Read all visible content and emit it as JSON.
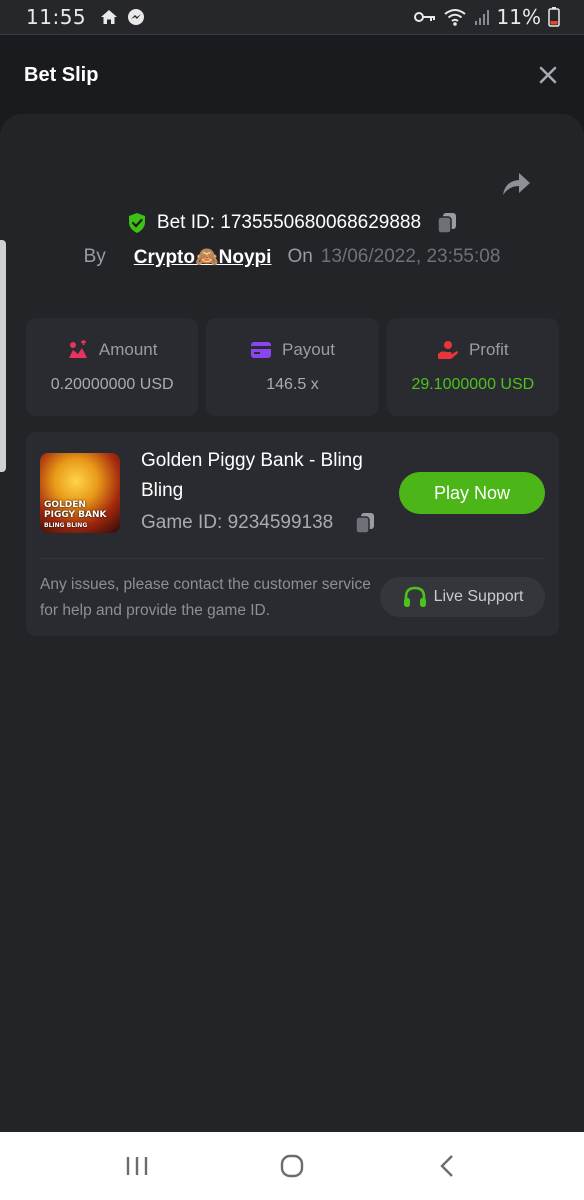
{
  "status_bar": {
    "time": "11:55",
    "battery_percent": "11%",
    "icons": [
      "home-icon",
      "messenger-icon",
      "vpn-key-icon",
      "wifi-icon",
      "signal-icon",
      "battery-icon"
    ]
  },
  "header": {
    "title": "Bet Slip",
    "close_icon": "close-icon"
  },
  "bet": {
    "bet_id_label": "Bet ID: 1735550680068629888",
    "by_label": "By",
    "user": "Crypto🙈Noypi",
    "on_label": "On",
    "date": "13/06/2022, 23:55:08"
  },
  "stats": [
    {
      "label": "Amount",
      "value": "0.20000000 USD",
      "icon": "amount-icon",
      "color": "#e8345a"
    },
    {
      "label": "Payout",
      "value": "146.5 x",
      "icon": "card-icon",
      "color": "#8b45f0"
    },
    {
      "label": "Profit",
      "value": "29.1000000 USD",
      "icon": "profit-hand-icon",
      "color": "#e8343a",
      "value_color": "#4cc21c"
    }
  ],
  "game": {
    "name": "Golden Piggy Bank - Bling Bling",
    "thumb_text": "GOLDEN PIGGY BANK",
    "thumb_subtext": "BLING BLING",
    "game_id_label": "Game ID: 9234599138",
    "play_label": "Play Now",
    "support_text": "Any issues, please contact the customer service for help and provide the game ID.",
    "support_label": "Live Support"
  },
  "colors": {
    "accent_green": "#4cb518",
    "background": "#1a1b1e",
    "card": "#2a2b30"
  }
}
